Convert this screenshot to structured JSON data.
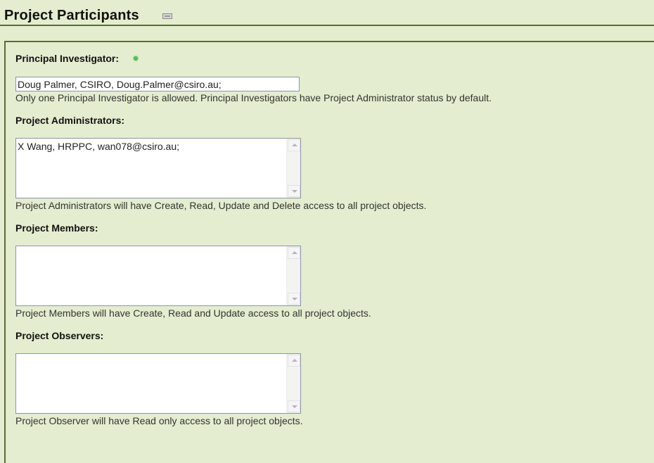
{
  "header": {
    "title": "Project Participants",
    "collapse_icon": "collapse-icon"
  },
  "principal_investigator": {
    "label": "Principal Investigator:",
    "required_icon": "required-dot-icon",
    "value": "Doug Palmer, CSIRO, Doug.Palmer@csiro.au;",
    "hint": "Only one Principal Investigator is allowed. Principal Investigators have Project Administrator status by default."
  },
  "administrators": {
    "label": "Project Administrators:",
    "value": "X Wang, HRPPC, wan078@csiro.au;",
    "hint": "Project Administrators will have Create, Read, Update and Delete access to all project objects."
  },
  "members": {
    "label": "Project Members:",
    "value": "",
    "hint": "Project Members will have Create, Read and Update access to all project objects."
  },
  "observers": {
    "label": "Project Observers:",
    "value": "",
    "hint": "Project Observer will have Read only access to all project objects."
  },
  "colors": {
    "background": "#e4edcf",
    "border": "#5c6b3c",
    "required": "#5cb85c"
  }
}
